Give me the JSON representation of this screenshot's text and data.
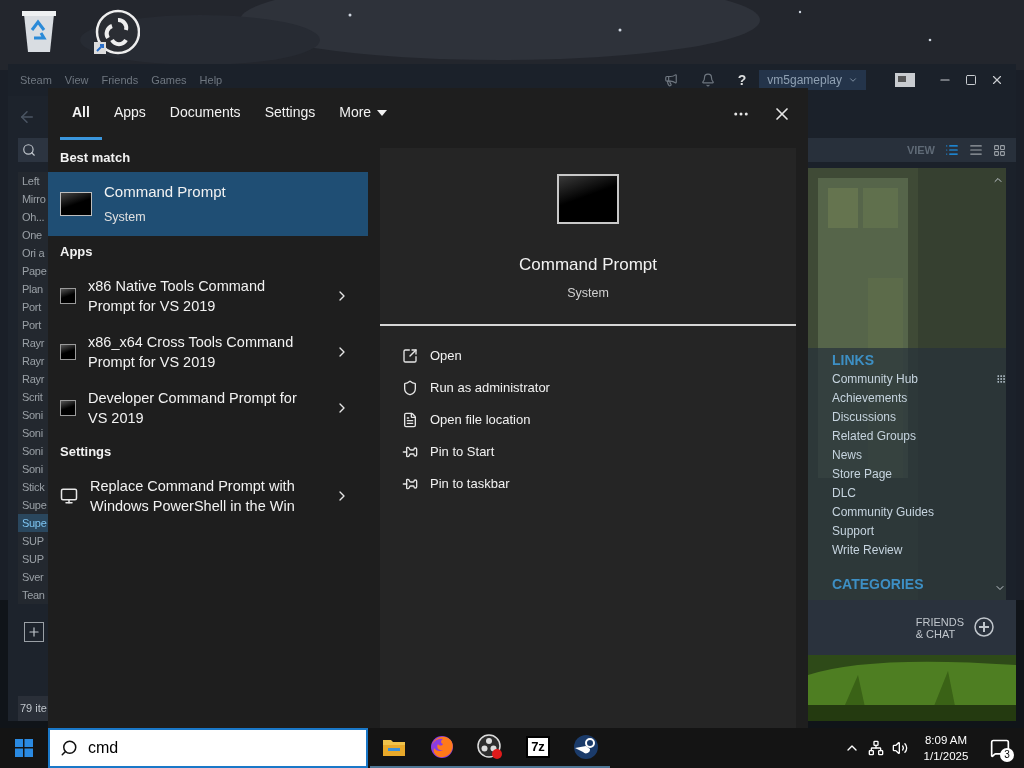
{
  "steam": {
    "menu": [
      "Steam",
      "View",
      "Friends",
      "Games",
      "Help"
    ],
    "help": "?",
    "account": "vm5gameplay",
    "games": [
      {
        "title": "Left",
        "selected": false
      },
      {
        "title": "Mirro",
        "selected": false
      },
      {
        "title": "Oh...",
        "selected": false
      },
      {
        "title": "One",
        "selected": false
      },
      {
        "title": "Ori a",
        "selected": false
      },
      {
        "title": "Pape",
        "selected": false
      },
      {
        "title": "Plan",
        "selected": false
      },
      {
        "title": "Port",
        "selected": false
      },
      {
        "title": "Port",
        "selected": false
      },
      {
        "title": "Rayr",
        "selected": false
      },
      {
        "title": "Rayr",
        "selected": false
      },
      {
        "title": "Rayr",
        "selected": false
      },
      {
        "title": "Scrit",
        "selected": false
      },
      {
        "title": "Soni",
        "selected": false
      },
      {
        "title": "Soni",
        "selected": false
      },
      {
        "title": "Soni",
        "selected": false
      },
      {
        "title": "Soni",
        "selected": false
      },
      {
        "title": "Stick",
        "selected": false
      },
      {
        "title": "Supe",
        "selected": false
      },
      {
        "title": "Supe",
        "selected": true
      },
      {
        "title": "SUP",
        "selected": false
      },
      {
        "title": "SUP",
        "selected": false
      },
      {
        "title": "Sver",
        "selected": false
      },
      {
        "title": "Tean",
        "selected": false
      }
    ],
    "count": "79 ite",
    "view_label": "VIEW",
    "links_heading": "LINKS",
    "links": [
      "Community Hub",
      "Achievements",
      "Discussions",
      "Related Groups",
      "News",
      "Store Page",
      "DLC",
      "Community Guides",
      "Support",
      "Write Review"
    ],
    "categories_heading": "CATEGORIES",
    "friends": [
      "FRIENDS",
      "& CHAT"
    ]
  },
  "search_menu": {
    "tabs": [
      {
        "label": "All",
        "selected": true,
        "kind": "tab"
      },
      {
        "label": "Apps",
        "selected": false,
        "kind": "tab"
      },
      {
        "label": "Documents",
        "selected": false,
        "kind": "tab"
      },
      {
        "label": "Settings",
        "selected": false,
        "kind": "tab"
      },
      {
        "label": "More",
        "selected": false,
        "kind": "dropdown"
      }
    ],
    "sections": [
      {
        "heading": "Best match",
        "results": [
          {
            "kind": "best",
            "title": "Command Prompt",
            "subtitle": "System",
            "selected": true
          }
        ]
      },
      {
        "heading": "Apps",
        "results": [
          {
            "kind": "app",
            "title": "x86 Native Tools Command Prompt for VS 2019",
            "selected": false
          },
          {
            "kind": "app",
            "title": "x86_x64 Cross Tools Command Prompt for VS 2019",
            "selected": false
          },
          {
            "kind": "app",
            "title": "Developer Command Prompt for VS 2019",
            "selected": false
          }
        ]
      },
      {
        "heading": "Settings",
        "results": [
          {
            "kind": "setting",
            "title": "Replace Command Prompt with Windows PowerShell in the Win",
            "selected": false
          }
        ]
      }
    ],
    "preview": {
      "title": "Command Prompt",
      "subtitle": "System",
      "actions": [
        {
          "kind": "open",
          "label": "Open"
        },
        {
          "kind": "admin",
          "label": "Run as administrator"
        },
        {
          "kind": "location",
          "label": "Open file location"
        },
        {
          "kind": "pin",
          "label": "Pin to Start"
        },
        {
          "kind": "pin",
          "label": "Pin to taskbar"
        }
      ]
    }
  },
  "taskbar": {
    "search": {
      "value": "cmd"
    },
    "apps": [
      {
        "kind": "folder"
      },
      {
        "kind": "browser"
      },
      {
        "kind": "recorder"
      },
      {
        "kind": "archiver",
        "label": "7z"
      },
      {
        "kind": "game"
      }
    ],
    "time": "8:09 AM",
    "date": "1/1/2025",
    "notifications": "3"
  }
}
